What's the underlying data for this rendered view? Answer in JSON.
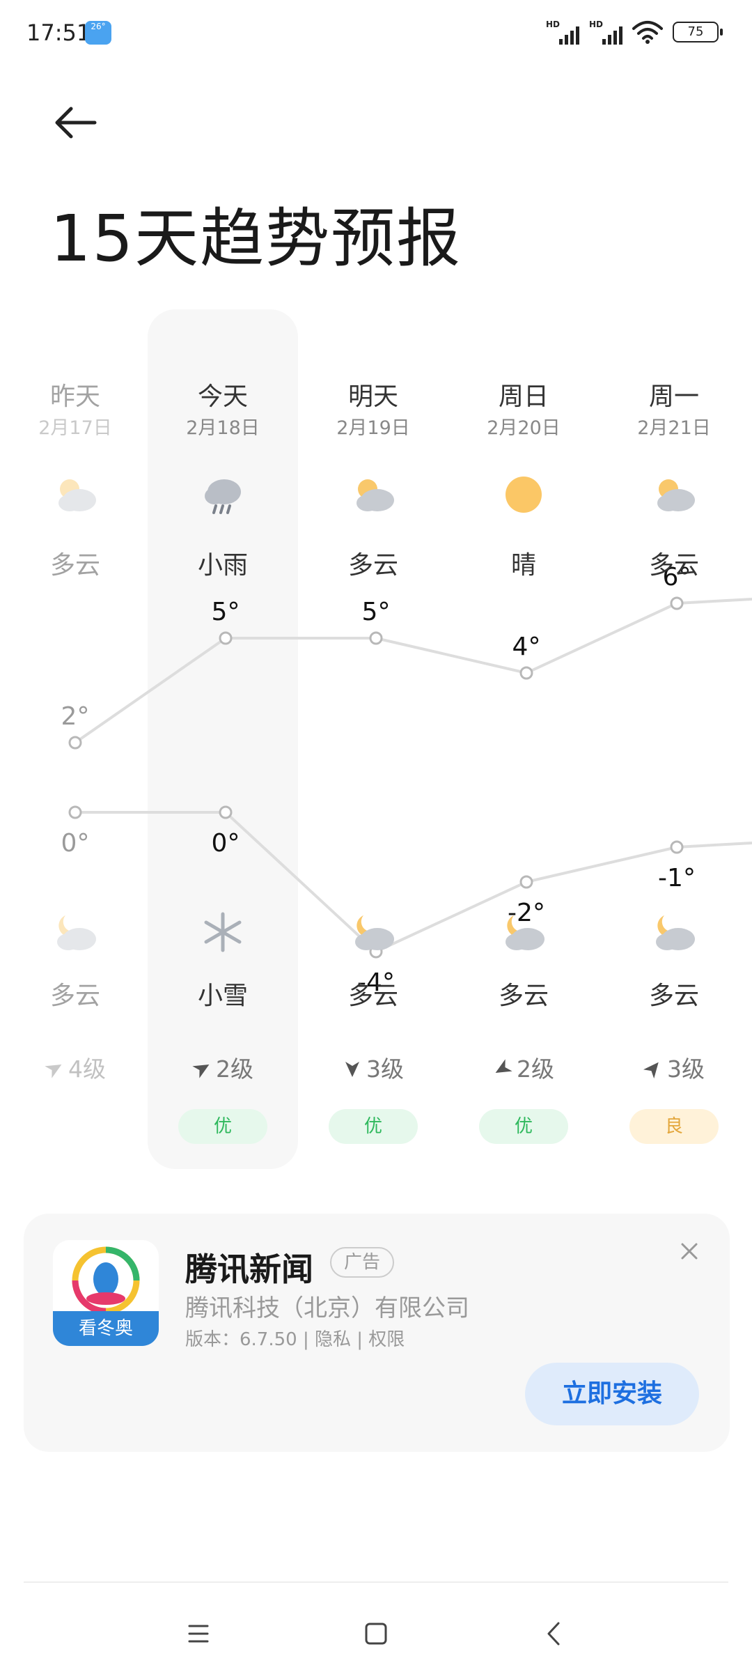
{
  "status_bar": {
    "time": "17:51",
    "weather_badge": "26°",
    "signal_1_label": "HD",
    "signal_2_label": "HD",
    "battery": "75"
  },
  "header": {
    "title": "15天趋势预报"
  },
  "forecast": {
    "days": [
      {
        "name": "昨天",
        "date": "2月17日",
        "day_icon": "partly-cloudy-icon",
        "day_condition": "多云",
        "high": "2°",
        "low": "0°",
        "night_icon": "partly-cloudy-night-icon",
        "night_condition": "多云",
        "wind": "4级",
        "aqi": ""
      },
      {
        "name": "今天",
        "date": "2月18日",
        "day_icon": "light-rain-icon",
        "day_condition": "小雨",
        "high": "5°",
        "low": "0°",
        "night_icon": "snow-icon",
        "night_condition": "小雪",
        "wind": "2级",
        "aqi": "优"
      },
      {
        "name": "明天",
        "date": "2月19日",
        "day_icon": "partly-cloudy-icon",
        "day_condition": "多云",
        "high": "5°",
        "low": "-4°",
        "night_icon": "partly-cloudy-night-icon",
        "night_condition": "多云",
        "wind": "3级",
        "aqi": "优"
      },
      {
        "name": "周日",
        "date": "2月20日",
        "day_icon": "sunny-icon",
        "day_condition": "晴",
        "high": "4°",
        "low": "-2°",
        "night_icon": "partly-cloudy-night-icon",
        "night_condition": "多云",
        "wind": "2级",
        "aqi": "优"
      },
      {
        "name": "周一",
        "date": "2月21日",
        "day_icon": "partly-cloudy-icon",
        "day_condition": "多云",
        "high": "6°",
        "low": "-1°",
        "night_icon": "partly-cloudy-night-icon",
        "night_condition": "多云",
        "wind": "3级",
        "aqi": "良"
      }
    ],
    "colors": {
      "aqi_good": "#2eb85c",
      "aqi_moderate": "#e3a63b",
      "line": "#dddddd"
    }
  },
  "ad": {
    "app_name": "腾讯新闻",
    "tag": "广告",
    "company": "腾讯科技（北京）有限公司",
    "meta": "版本：6.7.50 | 隐私 | 权限",
    "logo_badge": "看冬奥",
    "install_label": "立即安装"
  }
}
